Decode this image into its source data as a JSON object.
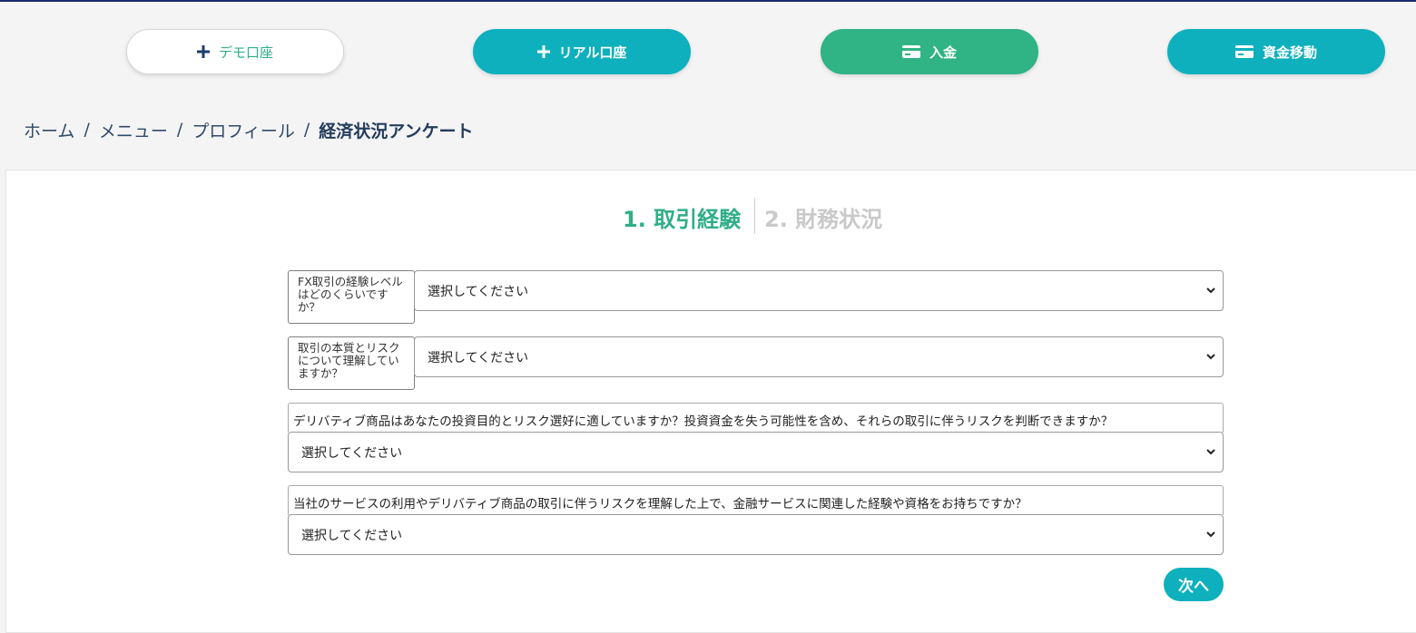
{
  "header": {
    "buttons": {
      "demo": {
        "label": "デモ口座",
        "icon": "plus-icon"
      },
      "real": {
        "label": "リアル口座",
        "icon": "plus-icon"
      },
      "deposit": {
        "label": "入金",
        "icon": "card-icon"
      },
      "transfer": {
        "label": "資金移動",
        "icon": "card-icon"
      }
    }
  },
  "breadcrumb": {
    "items": [
      "ホーム",
      "メニュー",
      "プロフィール"
    ],
    "separator": "/",
    "current": "経済状況アンケート"
  },
  "steps": {
    "step1": "1. 取引経験",
    "step2": "2. 財務状況"
  },
  "questions": [
    {
      "label": "FX取引の経験レベルはどのくらいですか？",
      "selected": "選択してください"
    },
    {
      "label": "取引の本質とリスクについて理解していますか？",
      "selected": "選択してください"
    },
    {
      "label": "デリバティブ商品はあなたの投資目的とリスク選好に適していますか？投資資金を失う可能性を含め、それらの取引に伴うリスクを判断できますか？",
      "selected": "選択してください"
    },
    {
      "label": "当社のサービスの利用やデリバティブ商品の取引に伴うリスクを理解した上で、金融サービスに関連した経験や資格をお持ちですか？",
      "selected": "選択してください"
    }
  ],
  "next_label": "次へ",
  "colors": {
    "teal": "#0fb0bd",
    "green": "#30b385",
    "navy": "#1d2a6b",
    "step_active": "#2fae87",
    "step_inactive": "#c9c9c9"
  }
}
